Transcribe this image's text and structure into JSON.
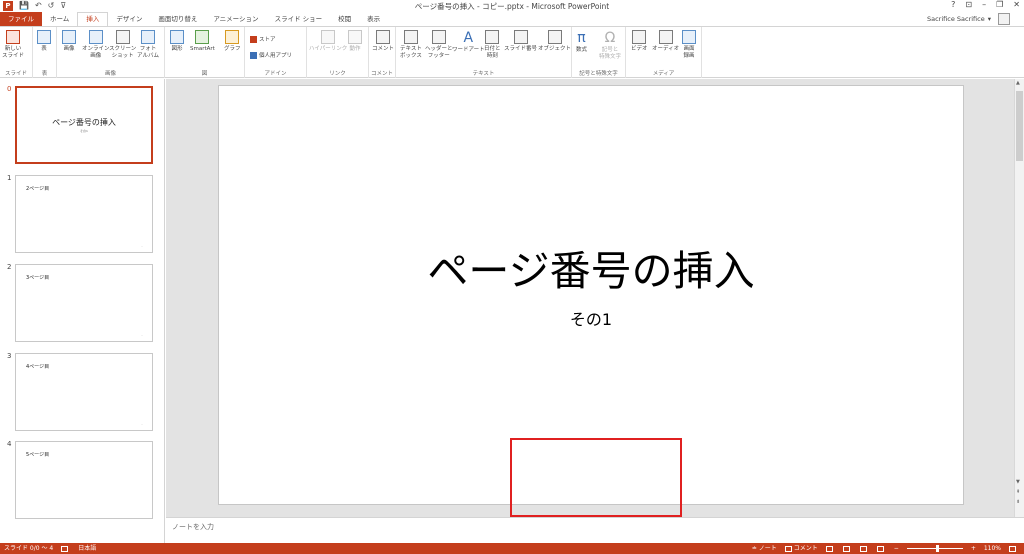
{
  "window": {
    "title": "ページ番号の挿入 - コピー.pptx - Microsoft PowerPoint",
    "controls": [
      "?",
      "⊡",
      "–",
      "❐",
      "✕"
    ]
  },
  "qat": {
    "logo": "P",
    "save": "💾",
    "undo": "↶",
    "redo": "↺",
    "custom": "⊽"
  },
  "tabs": [
    {
      "label": "ファイル",
      "kind": "file"
    },
    {
      "label": "ホーム"
    },
    {
      "label": "挿入",
      "active": true
    },
    {
      "label": "デザイン"
    },
    {
      "label": "画面切り替え"
    },
    {
      "label": "アニメーション"
    },
    {
      "label": "スライド ショー"
    },
    {
      "label": "校閲"
    },
    {
      "label": "表示"
    }
  ],
  "user": {
    "name": "Sacrifice Sacrifice",
    "caret": "▾"
  },
  "ribbon": {
    "groups": {
      "slide": "スライド",
      "table": "表",
      "images": "画像",
      "illustrations": "図",
      "apps": "アドイン",
      "links": "リンク",
      "comments": "コメント",
      "text": "テキスト",
      "symbols": "記号と特殊文字",
      "media": "メディア"
    },
    "buttons": {
      "new_slide": "新しい\nスライド",
      "table": "表",
      "pictures": "画像",
      "online_pictures": "オンライン\n画像",
      "screenshot": "スクリーン\nショット",
      "photo_album": "フォト\nアルバム",
      "shapes": "図形",
      "smartart": "SmartArt",
      "chart": "グラフ",
      "store": "ストア",
      "my_apps": "個人用アプリ",
      "hyperlink": "ハイパーリンク",
      "action": "動作",
      "comment": "コメント",
      "textbox": "テキスト\nボックス",
      "header_footer": "ヘッダーと\nフッター",
      "wordart": "ワードアート",
      "date_time": "日付と\n時刻",
      "slide_number": "スライド番号",
      "object": "オブジェクト",
      "equation": "数式",
      "symbol": "記号と\n特殊文字",
      "video": "ビデオ",
      "audio": "オーディオ",
      "screen_recording": "画面\n録画"
    }
  },
  "thumbnails": [
    {
      "num": "0",
      "title": "ページ番号の挿入",
      "sub": "その1",
      "selected": true
    },
    {
      "num": "1",
      "text": "2ページ目"
    },
    {
      "num": "2",
      "text": "3ページ目"
    },
    {
      "num": "3",
      "text": "4ページ目"
    },
    {
      "num": "4",
      "text": "5ページ目"
    }
  ],
  "slide": {
    "title": "ページ番号の挿入",
    "subtitle": "その1"
  },
  "notes": {
    "placeholder": "ノートを入力"
  },
  "status": {
    "slide_info": "スライド 0/0 ～ 4",
    "language": "日本語",
    "notes": "ノート",
    "comments": "コメント",
    "zoom": "110%",
    "zoom_level": 0.55
  }
}
